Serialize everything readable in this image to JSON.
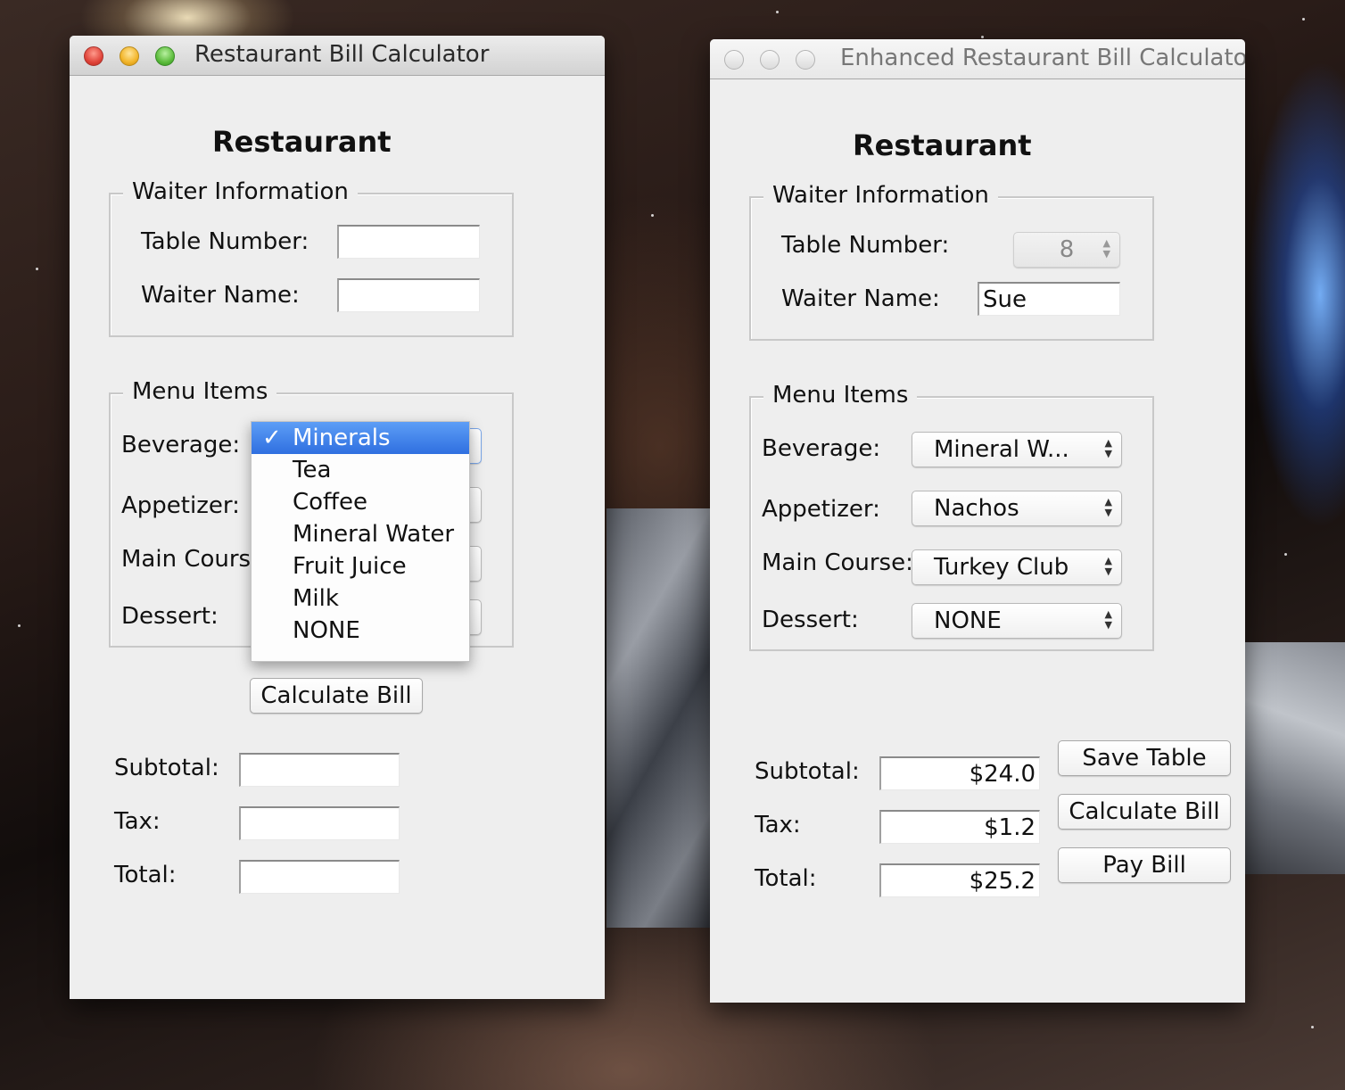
{
  "window1": {
    "title": "Restaurant Bill Calculator",
    "heading": "Restaurant",
    "waiter_group": "Waiter Information",
    "table_number_label": "Table Number:",
    "table_number_value": "",
    "waiter_name_label": "Waiter Name:",
    "waiter_name_value": "",
    "menu_group": "Menu Items",
    "beverage_label": "Beverage:",
    "appetizer_label": "Appetizer:",
    "main_course_label": "Main Course:",
    "dessert_label": "Dessert:",
    "beverage_dropdown": {
      "selected": "Minerals",
      "check_mark": "✓",
      "options": [
        "Minerals",
        "Tea",
        "Coffee",
        "Mineral Water",
        "Fruit Juice",
        "Milk",
        "NONE"
      ]
    },
    "calculate_button": "Calculate Bill",
    "subtotal_label": "Subtotal:",
    "subtotal_value": "",
    "tax_label": "Tax:",
    "tax_value": "",
    "total_label": "Total:",
    "total_value": ""
  },
  "window2": {
    "title": "Enhanced Restaurant Bill Calculator",
    "heading": "Restaurant",
    "waiter_group": "Waiter Information",
    "table_number_label": "Table Number:",
    "table_number_value": "8",
    "waiter_name_label": "Waiter Name:",
    "waiter_name_value": "Sue",
    "menu_group": "Menu Items",
    "beverage_label": "Beverage:",
    "beverage_value": "Mineral W...",
    "appetizer_label": "Appetizer:",
    "appetizer_value": "Nachos",
    "main_course_label": "Main Course:",
    "main_course_value": "Turkey Club",
    "dessert_label": "Dessert:",
    "dessert_value": "NONE",
    "subtotal_label": "Subtotal:",
    "subtotal_value": "$24.0",
    "tax_label": "Tax:",
    "tax_value": "$1.2",
    "total_label": "Total:",
    "total_value": "$25.2",
    "save_table_button": "Save Table",
    "calculate_button": "Calculate Bill",
    "pay_bill_button": "Pay Bill"
  },
  "combo_arrows": "▲\n▼"
}
